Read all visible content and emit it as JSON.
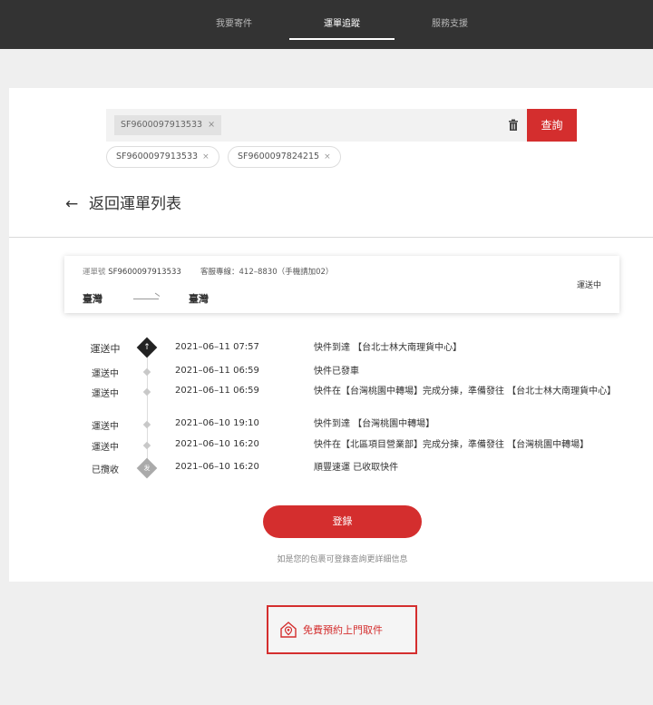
{
  "nav": {
    "tabs": [
      {
        "label": "我要寄件"
      },
      {
        "label": "運單追蹤"
      },
      {
        "label": "服務支援"
      }
    ]
  },
  "search": {
    "chip": "SF9600097913533",
    "chip_close": "×",
    "query_label": "查詢",
    "history": [
      {
        "label": "SF9600097913533",
        "close": "×"
      },
      {
        "label": "SF9600097824215",
        "close": "×"
      }
    ]
  },
  "back": {
    "arrow": "←",
    "label": "返回運單列表"
  },
  "waybill": {
    "number_label": "運單號",
    "number": "SF9600097913533",
    "phone": "客服專線：412–8830（手機請加02）",
    "from": "臺灣",
    "to": "臺灣",
    "status": "運送中"
  },
  "timeline": [
    {
      "status": "運送中",
      "time": "2021–06–11 07:57",
      "desc": "快件到達 【台北士林大南理貨中心】"
    },
    {
      "status": "運送中",
      "time": "2021–06–11 06:59",
      "desc": "快件已發車"
    },
    {
      "status": "運送中",
      "time": "2021–06–11 06:59",
      "desc": "快件在【台灣桃園中轉場】完成分揀，準備發往 【台北士林大南理貨中心】"
    },
    {
      "status": "運送中",
      "time": "2021–06–10 19:10",
      "desc": "快件到達 【台灣桃園中轉場】"
    },
    {
      "status": "運送中",
      "time": "2021–06–10 16:20",
      "desc": "快件在【北區項目營業部】完成分揀，準備發往 【台灣桃園中轉場】"
    },
    {
      "status": "已攬收",
      "time": "2021–06–10 16:20",
      "desc": "順豐速運 已收取快件"
    }
  ],
  "icons": {
    "up_arrow": "↑",
    "send_glyph": "发"
  },
  "login": {
    "button": "登錄",
    "hint": "如是您的包裹可登錄查詢更詳細信息"
  },
  "pickup": {
    "label": "免費預約上門取件"
  },
  "colors": {
    "accent": "#d42e2e",
    "nav_bg": "#333333"
  }
}
